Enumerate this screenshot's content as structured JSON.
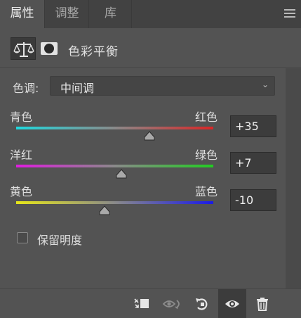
{
  "tabs": [
    {
      "label": "属性",
      "active": true
    },
    {
      "label": "调整",
      "active": false
    },
    {
      "label": "库",
      "active": false
    }
  ],
  "panel_menu_icon": "hamburger-menu-icon",
  "header": {
    "type_icon": "balance-scale-icon",
    "mask_icon": "layer-mask-icon",
    "title": "色彩平衡"
  },
  "tone": {
    "label": "色调:",
    "selected": "中间调"
  },
  "sliders": [
    {
      "left_label": "青色",
      "right_label": "红色",
      "value": "+35",
      "level": 35,
      "gradient": [
        "#1fd9df",
        "#d92626"
      ]
    },
    {
      "left_label": "洋红",
      "right_label": "绿色",
      "value": "+7",
      "level": 7,
      "gradient": [
        "#e01ce0",
        "#22cc22"
      ]
    },
    {
      "left_label": "黄色",
      "right_label": "蓝色",
      "value": "-10",
      "level": -10,
      "gradient": [
        "#e6e61a",
        "#1a1ae6"
      ]
    }
  ],
  "slider_range": [
    -100,
    100
  ],
  "preserve": {
    "label": "保留明度",
    "checked": false
  },
  "footer_icons": [
    "clip-to-layer-icon",
    "view-previous-state-icon",
    "reset-icon",
    "visibility-eye-icon",
    "delete-trash-icon"
  ]
}
